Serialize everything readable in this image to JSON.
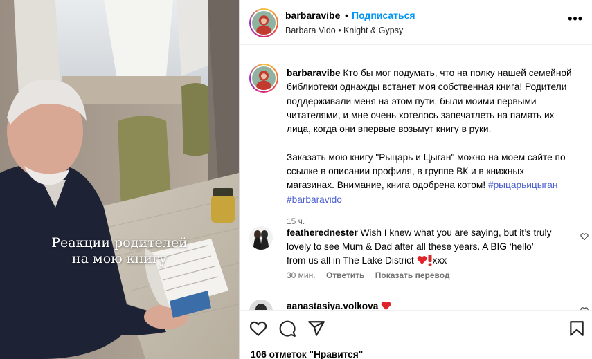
{
  "media": {
    "overlay_line1": "Реакции родителей",
    "overlay_line2": "на мою книгу"
  },
  "header": {
    "username": "barbaravibe",
    "separator": "•",
    "follow_label": "Подписаться",
    "subtitle": "Barbara Vido • Knight & Gypsy",
    "more_label": "•••"
  },
  "caption": {
    "username": "barbaravibe",
    "p1_l1": "Кто бы мог подумать, что на полку нашей семейной",
    "p1_l2": "библиотеки однажды встанет моя собственная книга! Родители",
    "p1_l3": "поддерживали меня на этом пути, были моими первыми",
    "p1_l4": "читателями, и мне очень хотелось запечатлеть на память их",
    "p1_l5": "лица, когда они впервые возьмут книгу в руки.",
    "p2_l1": "Заказать мою книгу \"Рыцарь и Цыган\" можно на моем сайте по",
    "p2_l2": "ссылке в описании профиля, в группе ВК и в книжных",
    "p2_l3": "магазинах. Внимание, книга одобрена котом!",
    "hashtag1": "#рыцарьицыган",
    "hashtag2": "#barbaravido",
    "time": "15 ч."
  },
  "comments": [
    {
      "username": "featherednester",
      "l1": "Wish I knew what you are saying, but it’s truly",
      "l2": "lovely to see Mum & Dad after all these years. A BIG ‘hello’",
      "l3": "from us all in The Lake District",
      "l3_suffix": "xxx",
      "time": "30 мин.",
      "reply_label": "Ответить",
      "translate_label": "Показать перевод"
    },
    {
      "username": "aanastasiya.volkova"
    }
  ],
  "actions": {
    "likes_text": "106 отметок \"Нравится\""
  },
  "colors": {
    "follow": "#0095f6",
    "hashtag": "#4a5fd0",
    "meta": "#737373"
  },
  "icons": [
    "heart-icon",
    "comment-icon",
    "share-icon",
    "bookmark-icon",
    "more-icon",
    "red-heart-emoji",
    "exclamation-emoji"
  ]
}
